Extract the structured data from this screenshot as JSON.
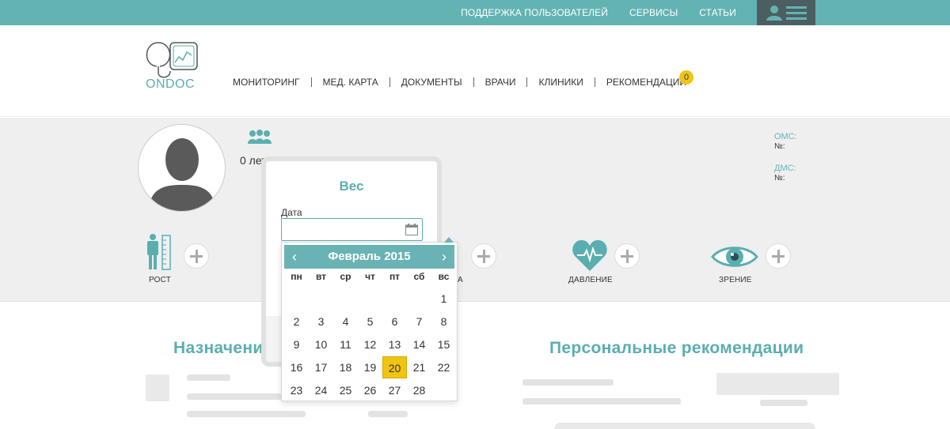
{
  "topbar": {
    "links": [
      "ПОДДЕРЖКА ПОЛЬЗОВАТЕЛЕЙ",
      "СЕРВИСЫ",
      "СТАТЬИ"
    ]
  },
  "logo": {
    "text": "ONDOC"
  },
  "nav": {
    "items": [
      "МОНИТОРИНГ",
      "МЕД. КАРТА",
      "ДОКУМЕНТЫ",
      "ВРАЧИ",
      "КЛИНИКИ",
      "РЕКОМЕНДАЦИИ"
    ],
    "badge": "0"
  },
  "profile": {
    "age": "0 лет",
    "oms_label": "ОМС:",
    "oms_no": "№:",
    "dms_label": "ДМС:",
    "dms_no": "№:"
  },
  "metrics": {
    "height": "РОСТ",
    "weight_partial": "А",
    "pressure": "ДАВЛЕНИЕ",
    "vision": "ЗРЕНИЕ"
  },
  "sections": {
    "appointments": "Назначени",
    "recommendations": "Персональные рекомендации"
  },
  "modal": {
    "title": "Вес",
    "date_label": "Дата",
    "date_value": ""
  },
  "calendar": {
    "month": "Февраль 2015",
    "prev": "‹",
    "next": "›",
    "weekdays": [
      "пн",
      "вт",
      "ср",
      "чт",
      "пт",
      "сб",
      "вс"
    ],
    "first_weekday_index": 6,
    "days_in_month": 28,
    "today": 20
  },
  "colors": {
    "accent": "#63b3b2",
    "dark": "#4d5e63",
    "highlight": "#f1c40f"
  }
}
